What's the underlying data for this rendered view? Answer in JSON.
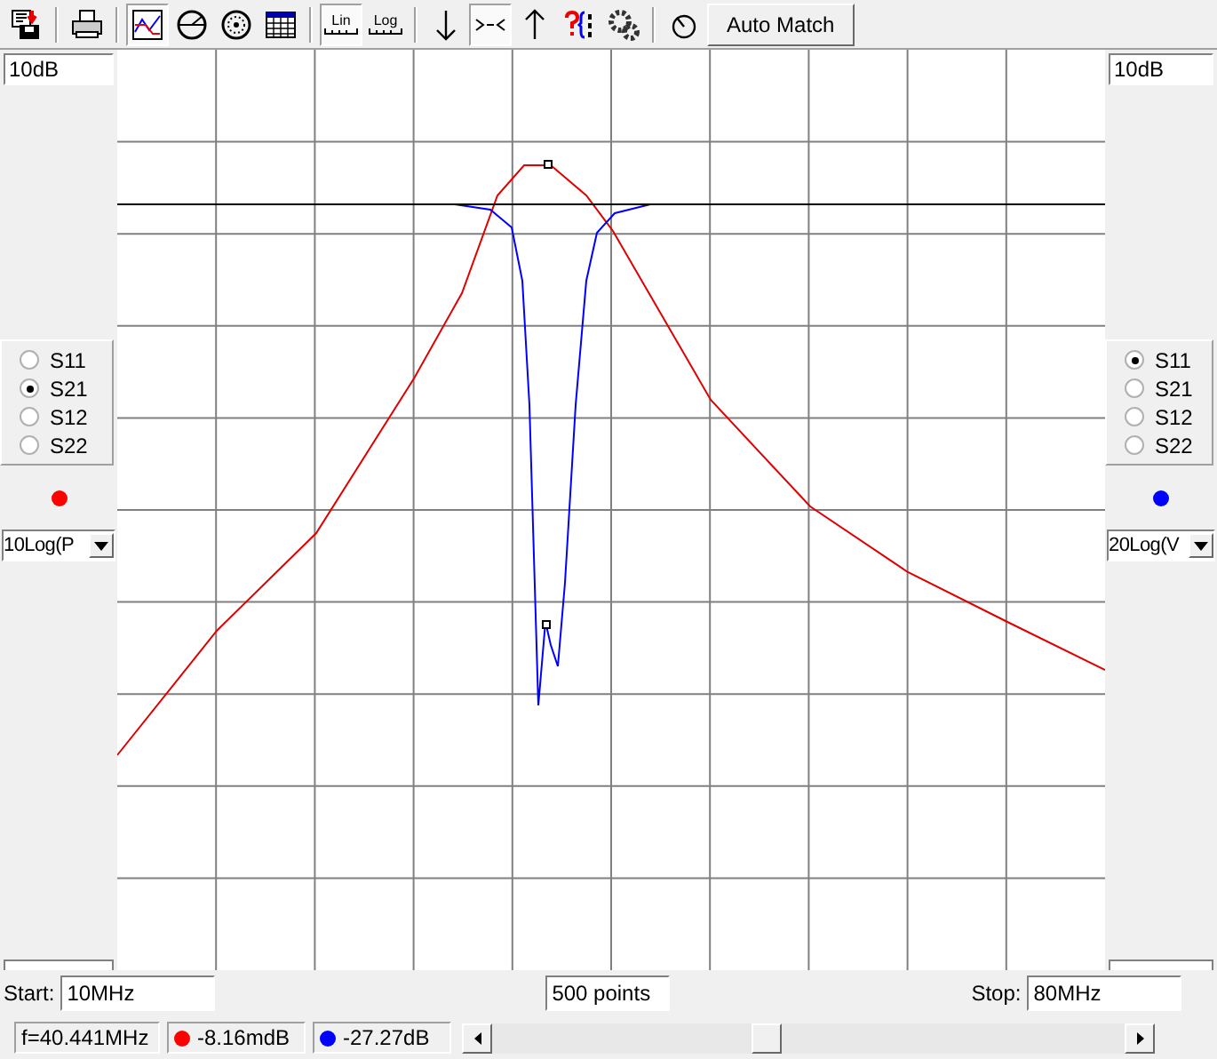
{
  "toolbar": {
    "buttons": [
      {
        "pressed": false
      },
      {
        "pressed": false
      },
      {
        "pressed": true
      },
      {
        "pressed": false
      },
      {
        "pressed": false
      },
      {
        "pressed": false
      },
      {
        "label": "Lin",
        "pressed": true
      },
      {
        "label": "Log",
        "pressed": false
      },
      {
        "pressed": false
      },
      {
        "pressed": true
      },
      {
        "pressed": false
      },
      {
        "pressed": false
      },
      {
        "pressed": false
      },
      {
        "pressed": false
      }
    ],
    "auto_match": "Auto Match"
  },
  "left_panel": {
    "scale": "10dB",
    "params": [
      {
        "label": "S11",
        "selected": false
      },
      {
        "label": "S21",
        "selected": true
      },
      {
        "label": "S12",
        "selected": false
      },
      {
        "label": "S22",
        "selected": false
      }
    ],
    "color": "#ff0000",
    "format": "10Log(P"
  },
  "right_panel": {
    "scale": "10dB",
    "params": [
      {
        "label": "S11",
        "selected": true
      },
      {
        "label": "S21",
        "selected": false
      },
      {
        "label": "S12",
        "selected": false
      },
      {
        "label": "S22",
        "selected": false
      }
    ],
    "color": "#0000ff",
    "format": "20Log(V"
  },
  "sweep": {
    "start_label": "Start:",
    "start": "10MHz",
    "points": "500 points",
    "stop_label": "Stop:",
    "stop": "80MHz"
  },
  "status": {
    "frequency": "f=40.441MHz",
    "readings": [
      {
        "value": "-8.16mdB",
        "color": "#ff0000"
      },
      {
        "value": "-27.27dB",
        "color": "#0000ff"
      }
    ]
  }
}
